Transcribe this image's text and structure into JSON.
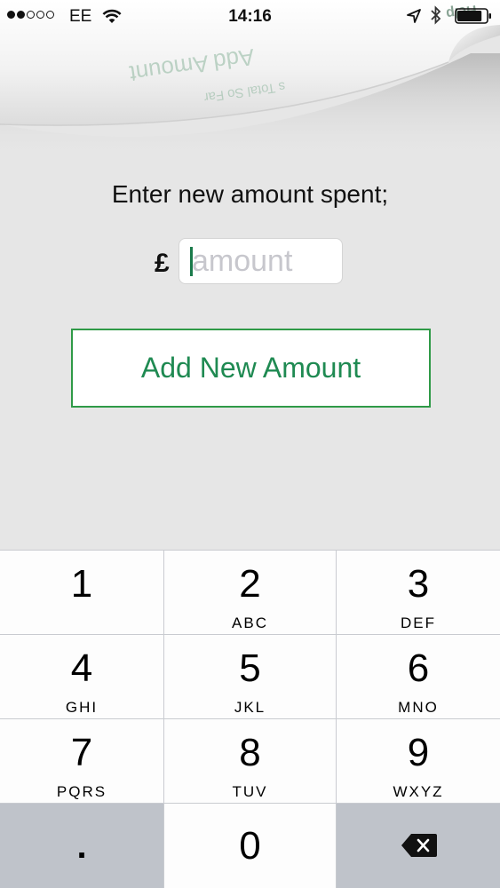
{
  "status_bar": {
    "carrier": "EE",
    "time": "14:16",
    "signal_filled": 2,
    "signal_total": 5,
    "battery_level": 0.85,
    "icons": [
      "wifi-icon",
      "location-icon",
      "bluetooth-icon",
      "battery-icon"
    ]
  },
  "page_curl": {
    "text_lines": [
      "Add Amount",
      "Help",
      "s Total So Far"
    ]
  },
  "form": {
    "prompt": "Enter new amount spent;",
    "currency_symbol": "£",
    "amount_value": "",
    "amount_placeholder": "amount",
    "submit_label": "Add New Amount"
  },
  "colors": {
    "accent_green": "#1f8a52",
    "button_border": "#2f9a47",
    "background": "#e6e6e6",
    "keypad_background": "#c9cbd0"
  },
  "keypad": {
    "keys": [
      {
        "digit": "1",
        "letters": ""
      },
      {
        "digit": "2",
        "letters": "ABC"
      },
      {
        "digit": "3",
        "letters": "DEF"
      },
      {
        "digit": "4",
        "letters": "GHI"
      },
      {
        "digit": "5",
        "letters": "JKL"
      },
      {
        "digit": "6",
        "letters": "MNO"
      },
      {
        "digit": "7",
        "letters": "PQRS"
      },
      {
        "digit": "8",
        "letters": "TUV"
      },
      {
        "digit": "9",
        "letters": "WXYZ"
      }
    ],
    "decimal": ".",
    "zero": "0",
    "delete_icon": "backspace-icon"
  }
}
